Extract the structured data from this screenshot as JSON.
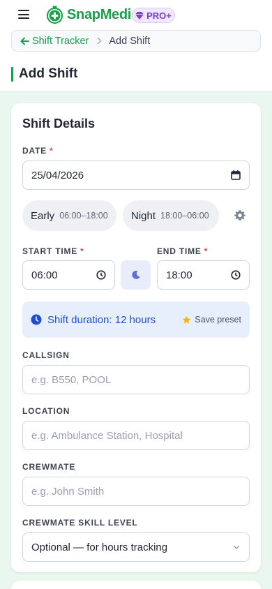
{
  "header": {
    "app_name": "SnapMedic",
    "pro_badge": "PRO+"
  },
  "breadcrumb": {
    "parent": "Shift Tracker",
    "current": "Add Shift"
  },
  "page_title": "Add Shift",
  "card": {
    "title": "Shift Details",
    "date": {
      "label": "DATE",
      "value": "25/04/2026"
    },
    "presets": [
      {
        "name": "Early",
        "time": "06:00–18:00"
      },
      {
        "name": "Night",
        "time": "18:00–06:00"
      }
    ],
    "start_time": {
      "label": "START TIME",
      "value": "06:00"
    },
    "end_time": {
      "label": "END TIME",
      "value": "18:00"
    },
    "duration": {
      "text": "Shift duration: 12 hours",
      "save_preset": "Save preset"
    },
    "callsign": {
      "label": "CALLSIGN",
      "placeholder": "e.g. B550, POOL"
    },
    "location": {
      "label": "LOCATION",
      "placeholder": "e.g. Ambulance Station, Hospital"
    },
    "crewmate": {
      "label": "CREWMATE",
      "placeholder": "e.g. John Smith"
    },
    "skill_level": {
      "label": "CREWMATE SKILL LEVEL",
      "value": "Optional — for hours tracking"
    },
    "required_mark": "*"
  },
  "colors": {
    "brand": "#1a9e4a",
    "pro": "#7a3fd1",
    "info": "#1d4ed8",
    "required": "#e0445a",
    "background": "#eaf7ee"
  },
  "icons": [
    "menu-icon",
    "logo-icon",
    "diamond-icon",
    "arrow-left-icon",
    "chevron-right-icon",
    "calendar-icon",
    "gear-icon",
    "clock-icon",
    "moon-icon",
    "star-icon",
    "chevron-down-icon"
  ]
}
